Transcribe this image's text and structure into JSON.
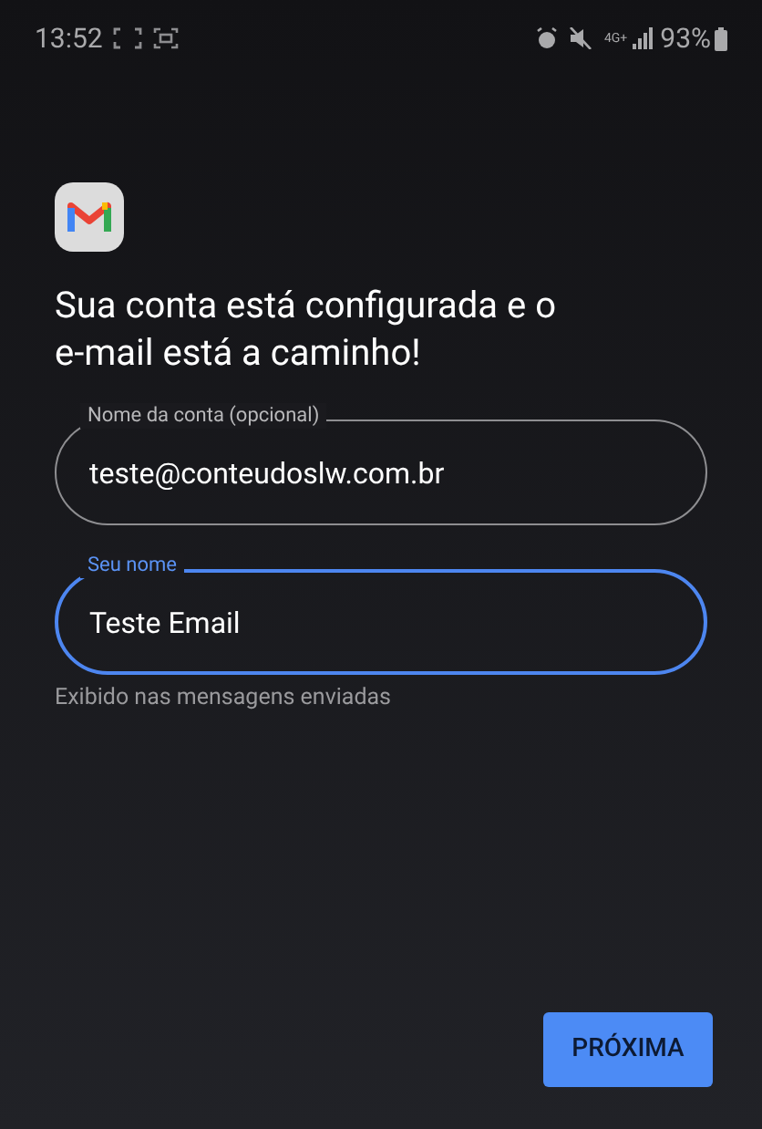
{
  "status_bar": {
    "time": "13:52",
    "network": "4G+",
    "battery": "93%"
  },
  "title": "Sua conta está configurada e o e-mail está a caminho!",
  "fields": [
    {
      "label": "Nome da conta (opcional)",
      "value": "teste@conteudoslw.com.br",
      "focused": false
    },
    {
      "label": "Seu nome",
      "value": "Teste Email",
      "focused": true,
      "helper": "Exibido nas mensagens enviadas"
    }
  ],
  "button": "PRÓXIMA"
}
